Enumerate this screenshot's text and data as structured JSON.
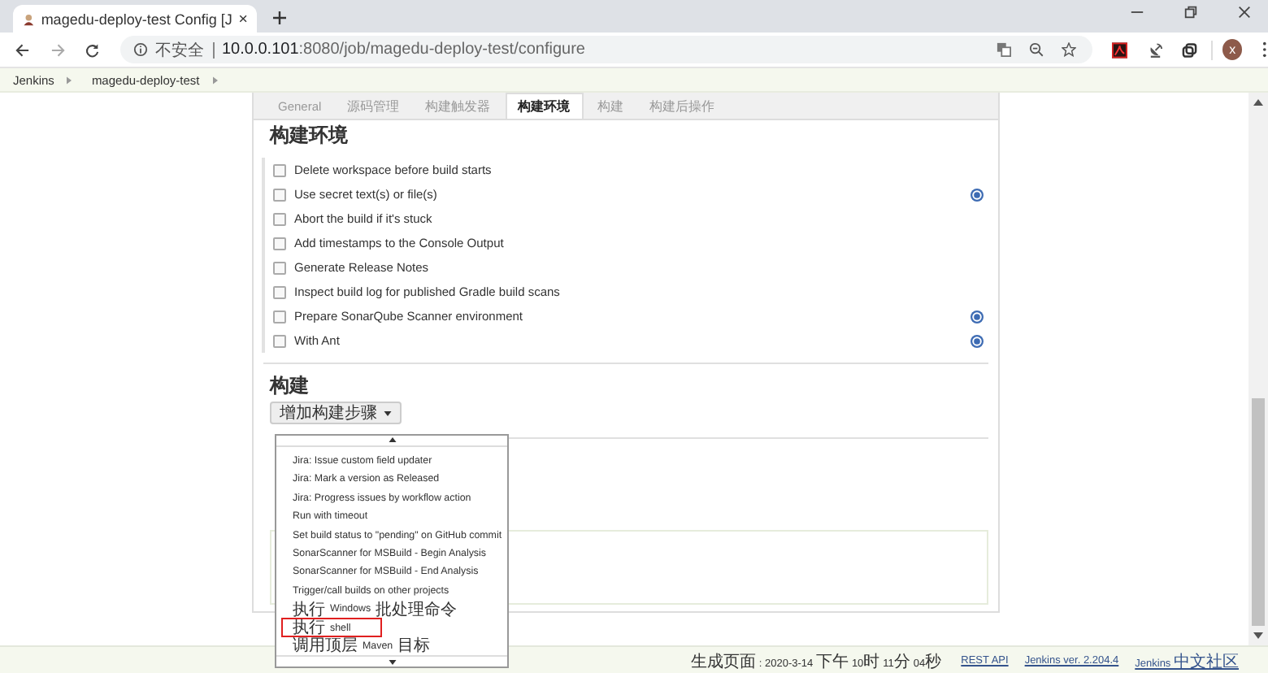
{
  "browser": {
    "tab_title": "magedu-deploy-test Config [J",
    "security_label": "不安全",
    "url_host": "10.0.0.101",
    "url_rest": ":8080/job/magedu-deploy-test/configure",
    "avatar_letter": "x"
  },
  "breadcrumbs": [
    "Jenkins",
    "magedu-deploy-test"
  ],
  "tabs": [
    {
      "label": "General",
      "selected": false
    },
    {
      "label": "源码管理",
      "selected": false
    },
    {
      "label": "构建触发器",
      "selected": false
    },
    {
      "label": "构建环境",
      "selected": true
    },
    {
      "label": "构建",
      "selected": false
    },
    {
      "label": "构建后操作",
      "selected": false
    }
  ],
  "build_environment": {
    "title": "构建环境",
    "options": [
      {
        "label": "Delete workspace before build starts",
        "checked": false,
        "help": false
      },
      {
        "label": "Use secret text(s) or file(s)",
        "checked": false,
        "help": true
      },
      {
        "label": "Abort the build if it's stuck",
        "checked": false,
        "help": false
      },
      {
        "label": "Add timestamps to the Console Output",
        "checked": false,
        "help": false
      },
      {
        "label": "Generate Release Notes",
        "checked": false,
        "help": false
      },
      {
        "label": "Inspect build log for published Gradle build scans",
        "checked": false,
        "help": false
      },
      {
        "label": "Prepare SonarQube Scanner environment",
        "checked": false,
        "help": true
      },
      {
        "label": "With Ant",
        "checked": false,
        "help": true
      }
    ]
  },
  "build": {
    "title": "构建",
    "add_button": "增加构建步骤",
    "menu_items": [
      {
        "label": "Jira: Issue custom field updater",
        "highlighted": false
      },
      {
        "label": "Jira: Mark a version as Released",
        "highlighted": false
      },
      {
        "label": "Jira: Progress issues by workflow action",
        "highlighted": false
      },
      {
        "label": "Run with timeout",
        "highlighted": false
      },
      {
        "label": "Set build status to \"pending\" on GitHub commit",
        "highlighted": false
      },
      {
        "label": "SonarScanner for MSBuild - Begin Analysis",
        "highlighted": false
      },
      {
        "label": "SonarScanner for MSBuild - End Analysis",
        "highlighted": false
      },
      {
        "label": "Trigger/call builds on other projects",
        "highlighted": false
      },
      {
        "label": "执行 Windows 批处理命令",
        "highlighted": false
      },
      {
        "label": "执行 shell",
        "highlighted": true
      },
      {
        "label": "调用顶层 Maven 目标",
        "highlighted": false
      }
    ]
  },
  "footer": {
    "generated": "生成页面: 2020-3-14 下午10时11分04秒",
    "links": [
      "REST API",
      "Jenkins ver. 2.204.4",
      "Jenkins 中文社区"
    ]
  }
}
